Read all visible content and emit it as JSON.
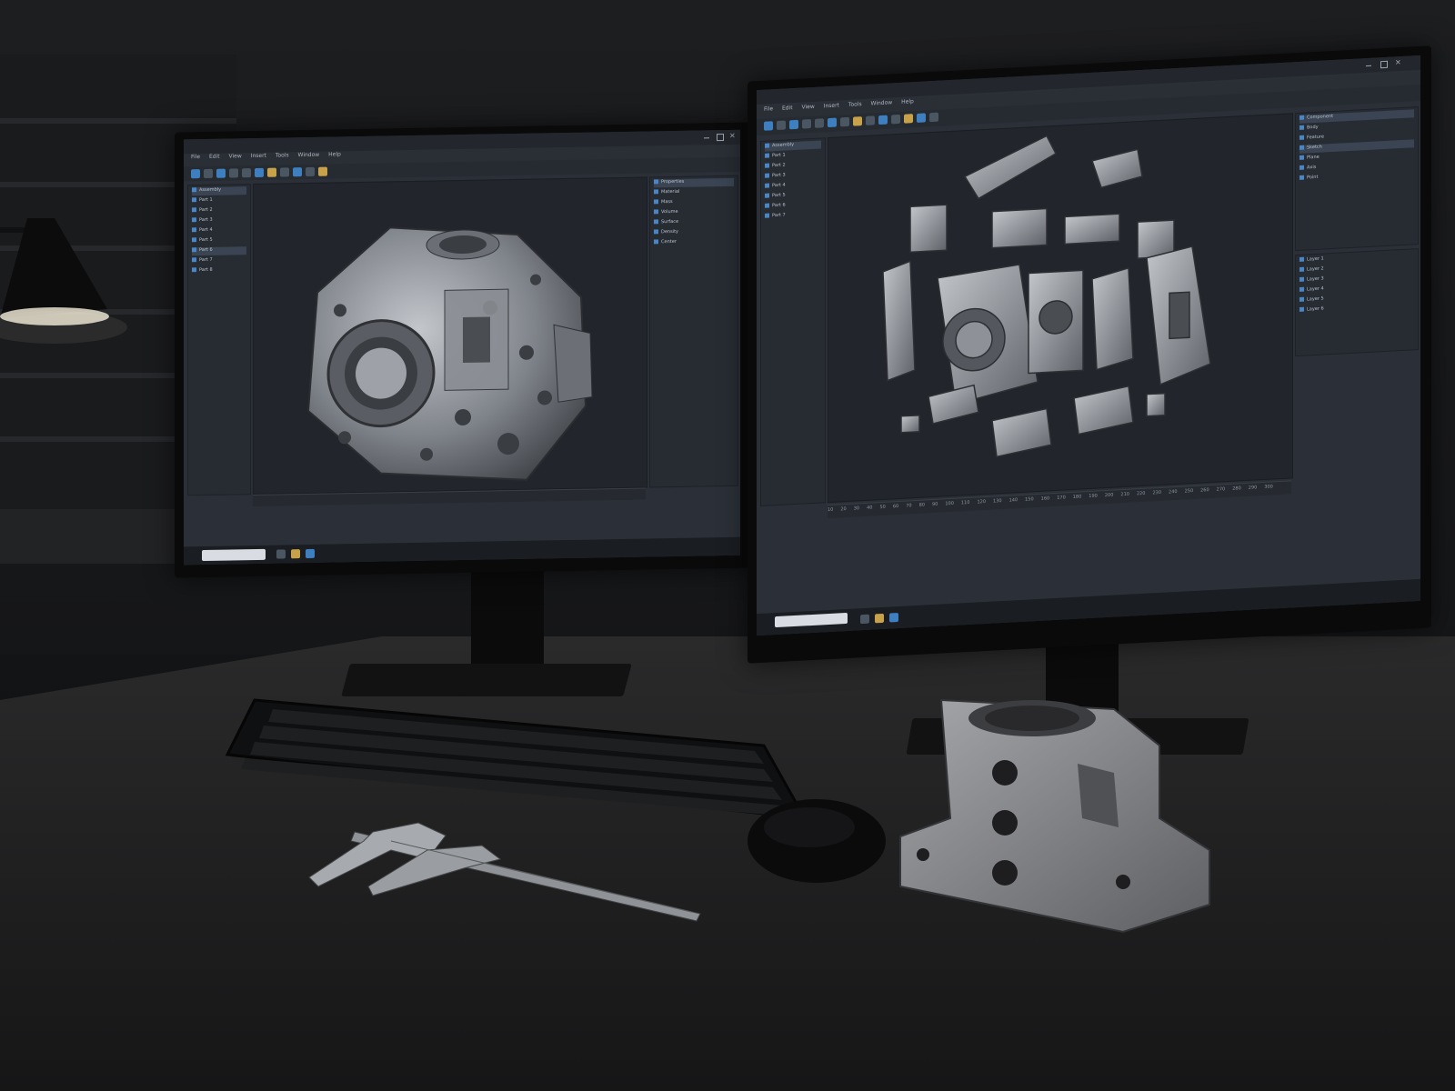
{
  "left_monitor": {
    "menu_items": [
      "File",
      "Edit",
      "View",
      "Insert",
      "Tools",
      "Window",
      "Help"
    ],
    "viewport_label": "3D model - assembled view",
    "tree_items": [
      "Assembly",
      "Part 1",
      "Part 2",
      "Part 3",
      "Part 4",
      "Part 5",
      "Part 6",
      "Part 7",
      "Part 8"
    ],
    "properties_items": [
      "Properties",
      "Material",
      "Mass",
      "Volume",
      "Surface",
      "Density",
      "Center"
    ]
  },
  "right_monitor": {
    "menu_items": [
      "File",
      "Edit",
      "View",
      "Insert",
      "Tools",
      "Window",
      "Help"
    ],
    "viewport_label": "3D model - exploded view",
    "tree_items": [
      "Assembly",
      "Part 1",
      "Part 2",
      "Part 3",
      "Part 4",
      "Part 5",
      "Part 6",
      "Part 7"
    ],
    "outline_items": [
      "Component",
      "Body",
      "Feature",
      "Sketch",
      "Plane",
      "Axis",
      "Point"
    ],
    "layer_items": [
      "Layer 1",
      "Layer 2",
      "Layer 3",
      "Layer 4",
      "Layer 5",
      "Layer 6"
    ],
    "ruler_ticks": [
      "10",
      "20",
      "30",
      "40",
      "50",
      "60",
      "70",
      "80",
      "90",
      "100",
      "110",
      "120",
      "130",
      "140",
      "150",
      "160",
      "170",
      "180",
      "190",
      "200",
      "210",
      "220",
      "230",
      "240",
      "250",
      "260",
      "270",
      "280",
      "290",
      "300"
    ]
  },
  "colors": {
    "screen_bg": "#22262c",
    "panel_bg": "#272c33",
    "accent_blue": "#3e7fbf",
    "model_metal": "#8d9096",
    "printed_part": "#8a8b8e",
    "desk": "#242425"
  },
  "objects": [
    "left-monitor",
    "right-monitor",
    "keyboard",
    "mouse",
    "caliper",
    "printed-part",
    "desk-lamp"
  ]
}
